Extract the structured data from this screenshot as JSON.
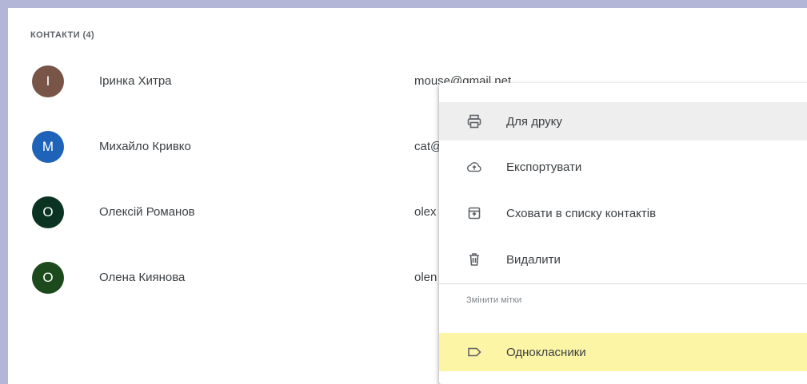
{
  "header": {
    "title": "КОНТАКТИ (4)"
  },
  "contacts": [
    {
      "initial": "І",
      "name": "Іринка Хитра",
      "email": "mouse@gmail.net",
      "avatar_color": "#795548"
    },
    {
      "initial": "M",
      "name": "Михайло Кривко",
      "email": "cat@",
      "avatar_color": "#1e63b8"
    },
    {
      "initial": "О",
      "name": "Олексій Романов",
      "email": "olex",
      "avatar_color": "#0b3322"
    },
    {
      "initial": "О",
      "name": "Олена Киянова",
      "email": "olen",
      "avatar_color": "#1d4a1c"
    }
  ],
  "menu": {
    "items": [
      {
        "label": "Для друку",
        "icon": "printer-icon"
      },
      {
        "label": "Експортувати",
        "icon": "cloud-upload-icon"
      },
      {
        "label": "Сховати в списку контактів",
        "icon": "hide-contact-icon"
      },
      {
        "label": "Видалити",
        "icon": "trash-icon"
      }
    ],
    "section_label": "Змінити мітки",
    "labels": [
      {
        "label": "Однокласники",
        "icon": "label-icon"
      }
    ]
  },
  "colors": {
    "page_background": "#b3b6d6",
    "hover_background": "#eeeeee",
    "selected_label_background": "#fdf5a6"
  }
}
